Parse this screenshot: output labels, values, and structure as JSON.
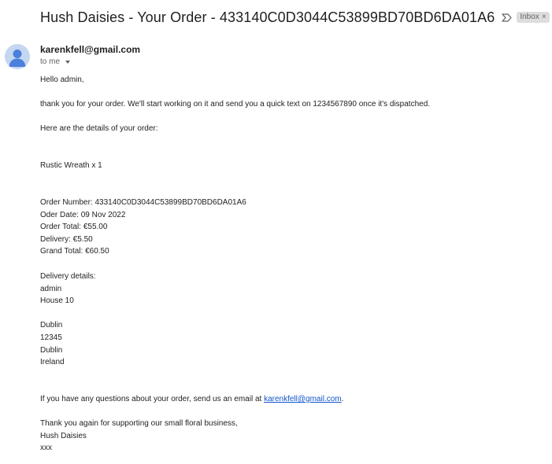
{
  "header": {
    "subject": "Hush Daisies - Your Order - 433140C0D3044C53899BD70BD6DA01A6",
    "label": "Inbox",
    "label_close": "×"
  },
  "message": {
    "sender": "karenkfell@gmail.com",
    "recipient": "to me",
    "greeting": "Hello admin,",
    "intro": "thank you for your order. We'll start working on it and send you a quick text on 1234567890 once it's dispatched.",
    "details_heading": "Here are the details of your order:",
    "item": "Rustic Wreath x 1",
    "order_number": "Order Number: 433140C0D3044C53899BD70BD6DA01A6",
    "order_date": "Oder Date: 09 Nov 2022",
    "order_total": "Order Total: €55.00",
    "delivery_cost": "Delivery: €5.50",
    "grand_total": "Grand Total: €60.50",
    "delivery_heading": "Delivery details:",
    "address": [
      "admin",
      "House 10",
      "",
      "Dublin",
      "12345",
      "Dublin",
      "Ireland"
    ],
    "questions_prefix": "If you have any questions about your order, send us an email at ",
    "questions_email": "karenkfell@gmail.com",
    "questions_suffix": ".",
    "thanks": "Thank you again for supporting our small floral business,",
    "signature": "Hush Daisies",
    "signoff": "xxx"
  }
}
